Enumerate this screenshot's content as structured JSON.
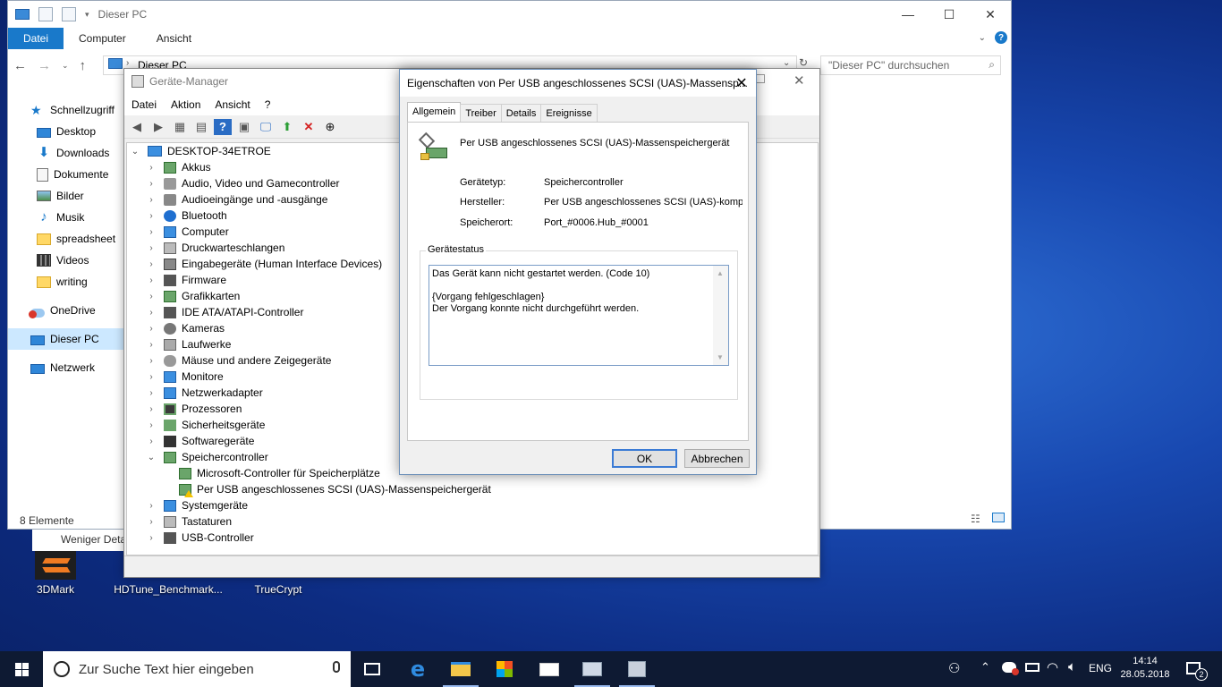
{
  "explorer": {
    "title": "Dieser PC",
    "ribbon_tabs": [
      "Datei",
      "Computer",
      "Ansicht"
    ],
    "address": "Dieser PC",
    "search_placeholder": "\"Dieser PC\" durchsuchen",
    "nav": [
      {
        "label": "Schnellzugriff",
        "icon": "star-icon"
      },
      {
        "label": "Desktop",
        "icon": "desktop-icon"
      },
      {
        "label": "Downloads",
        "icon": "download-icon"
      },
      {
        "label": "Dokumente",
        "icon": "document-icon"
      },
      {
        "label": "Bilder",
        "icon": "pictures-icon"
      },
      {
        "label": "Musik",
        "icon": "music-icon"
      },
      {
        "label": "spreadsheet",
        "icon": "folder-icon"
      },
      {
        "label": "Videos",
        "icon": "video-icon"
      },
      {
        "label": "writing",
        "icon": "folder-icon"
      },
      {
        "label": "OneDrive",
        "icon": "cloud-icon"
      },
      {
        "label": "Dieser PC",
        "icon": "computer-icon"
      },
      {
        "label": "Netzwerk",
        "icon": "network-icon"
      }
    ],
    "status": "8 Elemente",
    "details_toggle": "Weniger Details"
  },
  "devmgr": {
    "title": "Geräte-Manager",
    "menu": [
      "Datei",
      "Aktion",
      "Ansicht",
      "?"
    ],
    "root": "DESKTOP-34ETROE",
    "categories": [
      "Akkus",
      "Audio, Video und Gamecontroller",
      "Audioeingänge und -ausgänge",
      "Bluetooth",
      "Computer",
      "Druckwarteschlangen",
      "Eingabegeräte (Human Interface Devices)",
      "Firmware",
      "Grafikkarten",
      "IDE ATA/ATAPI-Controller",
      "Kameras",
      "Laufwerke",
      "Mäuse und andere Zeigegeräte",
      "Monitore",
      "Netzwerkadapter",
      "Prozessoren",
      "Sicherheitsgeräte",
      "Softwaregeräte",
      "Speichercontroller",
      "Microsoft-Controller für Speicherplätze",
      "Per USB angeschlossenes SCSI (UAS)-Massenspeichergerät",
      "Systemgeräte",
      "Tastaturen",
      "USB-Controller"
    ]
  },
  "dialog": {
    "title": "Eigenschaften von Per USB angeschlossenes SCSI (UAS)-Massensp...",
    "tabs": [
      "Allgemein",
      "Treiber",
      "Details",
      "Ereignisse"
    ],
    "device_name": "Per USB angeschlossenes SCSI (UAS)-Massenspeichergerät",
    "fields": {
      "type_label": "Gerätetyp:",
      "type_value": "Speichercontroller",
      "mfr_label": "Hersteller:",
      "mfr_value": "Per USB angeschlossenes SCSI (UAS)-kompa",
      "loc_label": "Speicherort:",
      "loc_value": "Port_#0006.Hub_#0001"
    },
    "status_group": "Gerätestatus",
    "status_line1": "Das Gerät kann nicht gestartet werden. (Code 10)",
    "status_line2": "{Vorgang fehlgeschlagen}",
    "status_line3": "Der Vorgang konnte nicht durchgeführt werden.",
    "ok": "OK",
    "cancel": "Abbrechen"
  },
  "desktop_icons": [
    "3DMark",
    "HDTune_Benchmark...",
    "TrueCrypt"
  ],
  "taskbar": {
    "search_placeholder": "Zur Suche Text hier eingeben",
    "lang": "ENG",
    "time": "14:14",
    "date": "28.05.2018",
    "notifications": "2"
  }
}
